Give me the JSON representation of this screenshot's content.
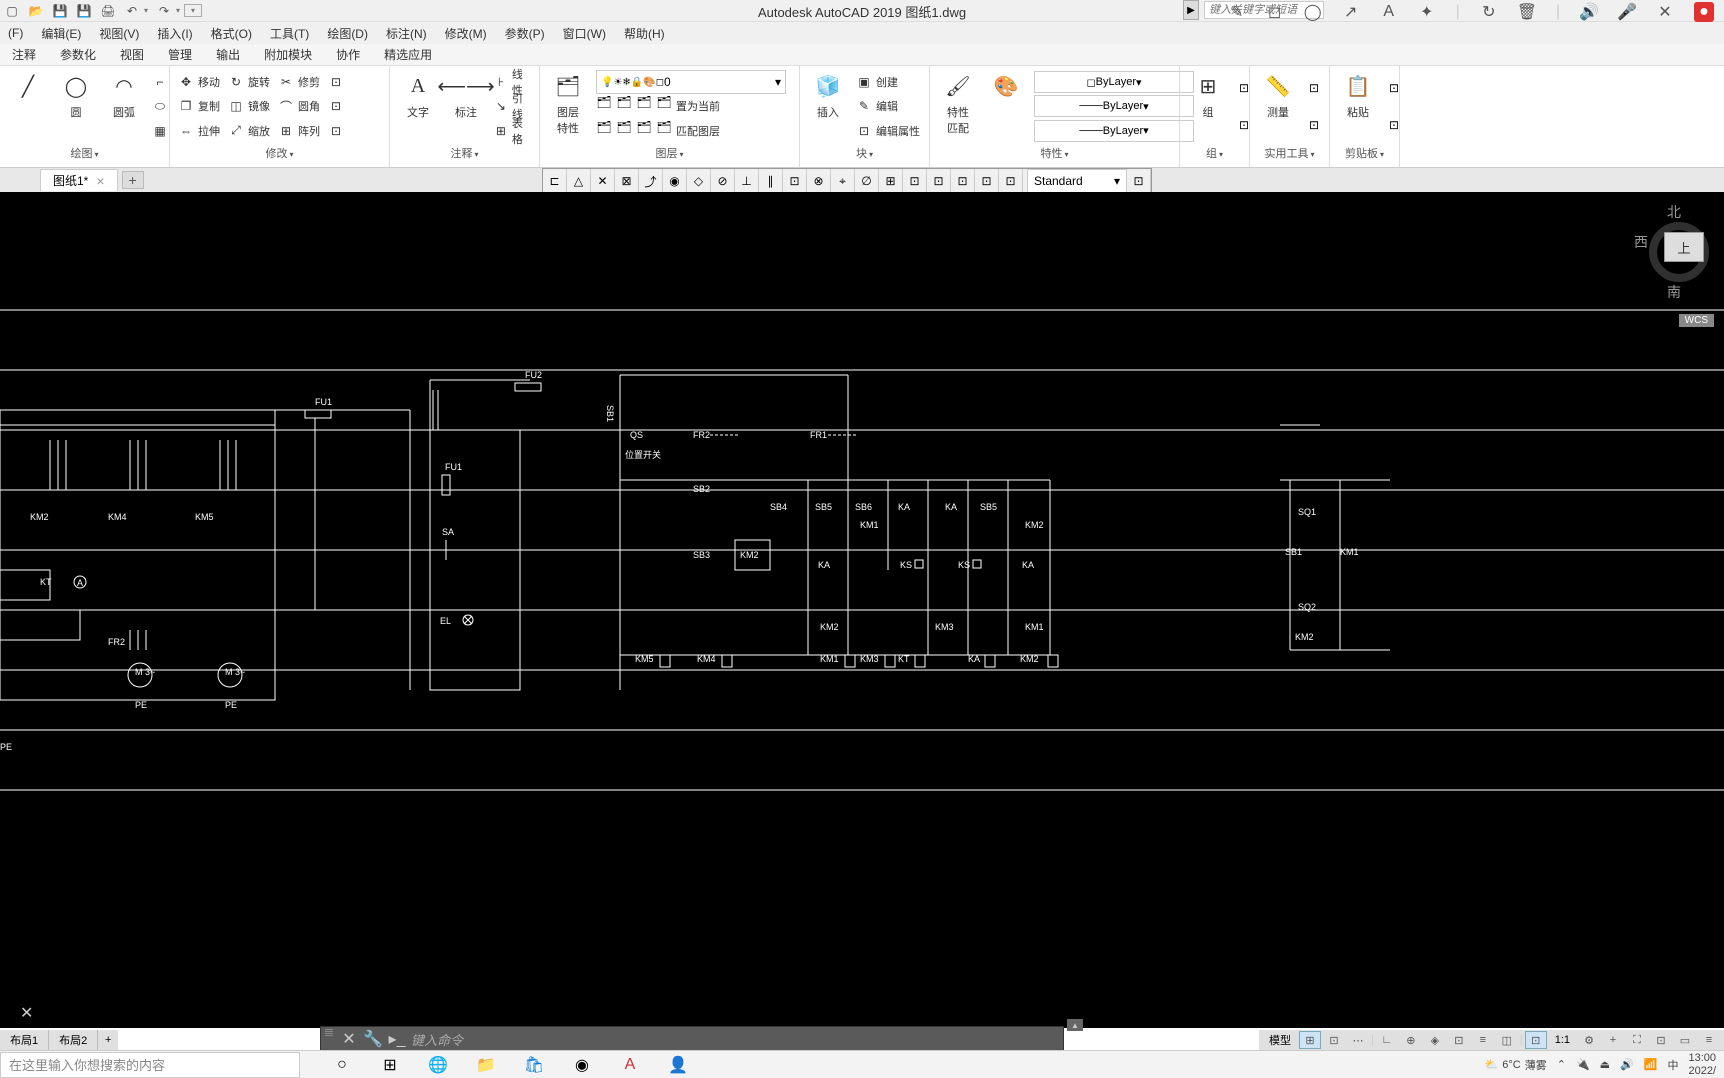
{
  "app_title": "Autodesk AutoCAD 2019   图纸1.dwg",
  "search_placeholder": "键入关键字或短语",
  "menu": {
    "file": "(F)",
    "edit": "编辑(E)",
    "view": "视图(V)",
    "insert": "插入(I)",
    "format": "格式(O)",
    "tools": "工具(T)",
    "draw": "绘图(D)",
    "dimension": "标注(N)",
    "modify": "修改(M)",
    "param": "参数(P)",
    "window": "窗口(W)",
    "help": "帮助(H)"
  },
  "tabs": {
    "annotate": "注释",
    "parametric": "参数化",
    "view": "视图",
    "manage": "管理",
    "output": "输出",
    "addins": "附加模块",
    "collab": "协作",
    "featured": "精选应用"
  },
  "panels": {
    "draw": {
      "title": "绘图",
      "line": "直线",
      "polyline": "多段线",
      "circle": "圆",
      "arc": "圆弧"
    },
    "modify": {
      "title": "修改",
      "move": "移动",
      "rotate": "旋转",
      "trim": "修剪",
      "copy": "复制",
      "mirror": "镜像",
      "fillet": "圆角",
      "stretch": "拉伸",
      "scale": "缩放",
      "array": "阵列"
    },
    "annot": {
      "title": "注释",
      "text": "文字",
      "dim": "标注",
      "linear": "线性",
      "leader": "引线",
      "table": "表格"
    },
    "layer": {
      "title": "图层",
      "props": "图层\n特性",
      "current": "0",
      "setcurrent": "置为当前",
      "match": "匹配图层"
    },
    "block": {
      "title": "块",
      "insert": "插入",
      "create": "创建",
      "edit": "编辑",
      "editattr": "编辑属性"
    },
    "props": {
      "title": "特性",
      "match": "特性\n匹配",
      "bylayer": "ByLayer"
    },
    "group": {
      "title": "组",
      "group": "组"
    },
    "utils": {
      "title": "实用工具",
      "measure": "测量"
    },
    "clip": {
      "title": "剪贴板",
      "paste": "粘贴"
    }
  },
  "doctab": {
    "name": "图纸1*"
  },
  "snap_style": "Standard",
  "viewcube": {
    "n": "北",
    "w": "西",
    "s": "南",
    "top": "上",
    "wcs": "WCS"
  },
  "cmd_placeholder": "键入命令",
  "layout": {
    "l1": "布局1",
    "l2": "布局2"
  },
  "status": {
    "model": "模型",
    "scale": "1:1"
  },
  "taskbar": {
    "search": "在这里输入你想搜索的内容",
    "weather_temp": "6°C",
    "weather_cond": "薄雾",
    "ime": "中",
    "time": "13:00",
    "date": "2022/"
  },
  "drawing_labels": {
    "fu1": "FU1",
    "fu1b": "FU1",
    "fu2": "FU2",
    "sa": "SA",
    "el": "EL",
    "km2": "KM2",
    "km4": "KM4",
    "km5": "KM5",
    "kt": "KT",
    "a": "A",
    "fr2": "FR2",
    "pe": "PE",
    "m3": "M\n3~",
    "sb1": "SB1",
    "qs": "QS",
    "pos": "位置开关",
    "sb2": "SB2",
    "sb3": "SB3",
    "sb4": "SB4",
    "sb5": "SB5",
    "sb6": "SB6",
    "fr1": "FR1",
    "ka": "KA",
    "km1": "KM1",
    "km3": "KM3",
    "ks": "KS",
    "km5b": "KM5",
    "km4b": "KM4",
    "km1b": "KM1",
    "km3b": "KM3",
    "ktb": "KT",
    "kab": "KA",
    "km2b": "KM2",
    "sq1": "SQ1",
    "sq2": "SQ2"
  }
}
